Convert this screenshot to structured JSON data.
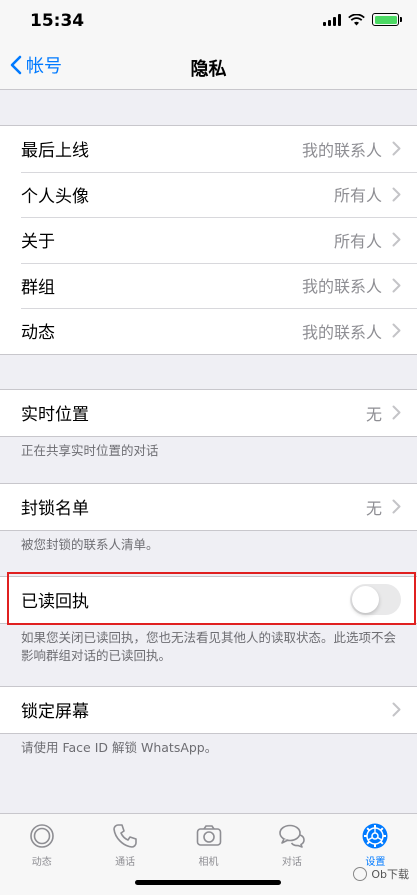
{
  "status": {
    "time": "15:34"
  },
  "nav": {
    "back_label": "帐号",
    "title": "隐私"
  },
  "group1": [
    {
      "label": "最后上线",
      "value": "我的联系人"
    },
    {
      "label": "个人头像",
      "value": "所有人"
    },
    {
      "label": "关于",
      "value": "所有人"
    },
    {
      "label": "群组",
      "value": "我的联系人"
    },
    {
      "label": "动态",
      "value": "我的联系人"
    }
  ],
  "live_location": {
    "label": "实时位置",
    "value": "无",
    "footnote": "正在共享实时位置的对话"
  },
  "blocked": {
    "label": "封锁名单",
    "value": "无",
    "footnote": "被您封锁的联系人清单。"
  },
  "read_receipts": {
    "label": "已读回执",
    "enabled": false,
    "footnote": "如果您关闭已读回执，您也无法看见其他人的读取状态。此选项不会影响群组对话的已读回执。"
  },
  "screen_lock": {
    "label": "锁定屏幕",
    "footnote": "请使用 Face ID 解锁 WhatsApp。"
  },
  "tabs": [
    {
      "label": "动态",
      "icon": "status-icon",
      "active": false
    },
    {
      "label": "通话",
      "icon": "phone-icon",
      "active": false
    },
    {
      "label": "相机",
      "icon": "camera-icon",
      "active": false
    },
    {
      "label": "对话",
      "icon": "chats-icon",
      "active": false
    },
    {
      "label": "设置",
      "icon": "settings-icon",
      "active": true
    }
  ],
  "watermark": "Ob下载",
  "colors": {
    "accent": "#007aff",
    "highlight": "#e02020",
    "battery": "#4cd964"
  }
}
